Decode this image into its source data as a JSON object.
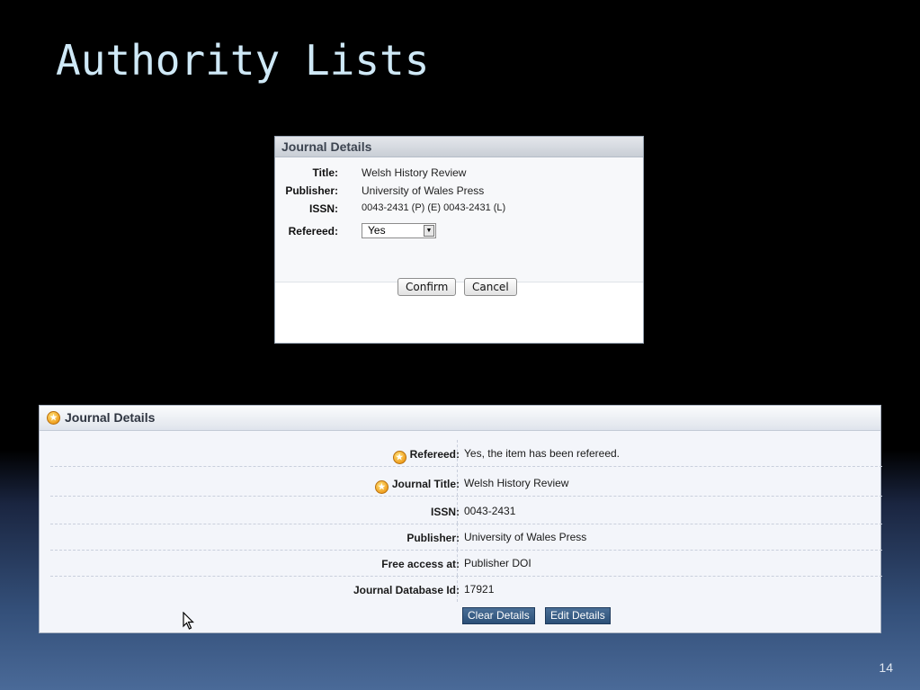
{
  "slide": {
    "title": "Authority Lists",
    "page_number": "14"
  },
  "dialog": {
    "title": "Journal Details",
    "fields": [
      {
        "label": "Title:",
        "value": "Welsh History Review"
      },
      {
        "label": "Publisher:",
        "value": "University of Wales Press"
      },
      {
        "label": "ISSN:",
        "value": "0043-2431 (P) (E) 0043-2431 (L)"
      }
    ],
    "refereed_label": "Refereed:",
    "refereed_value": "Yes",
    "confirm_label": "Confirm",
    "cancel_label": "Cancel"
  },
  "details": {
    "title": "Journal Details",
    "rows": [
      {
        "label": "Refereed:",
        "value": "Yes, the item has been refereed.",
        "icon": "star-icon"
      },
      {
        "label": "Journal Title:",
        "value": "Welsh History Review",
        "icon": "star-icon"
      },
      {
        "label": "ISSN:",
        "value": "0043-2431"
      },
      {
        "label": "Publisher:",
        "value": "University of Wales Press"
      },
      {
        "label": "Free access at:",
        "value": "Publisher DOI"
      },
      {
        "label": "Journal Database Id:",
        "value": "17921"
      }
    ],
    "clear_label": "Clear Details",
    "edit_label": "Edit Details"
  },
  "colors": {
    "title_text": "#cfe9f7",
    "star_icon": "#f0a020",
    "button_blue": "#2b4f78"
  }
}
